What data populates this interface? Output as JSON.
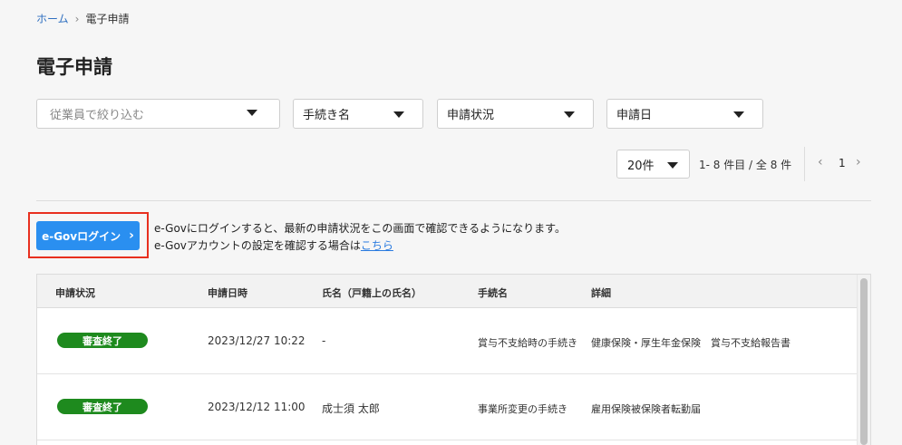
{
  "breadcrumb": {
    "home": "ホーム",
    "current": "電子申請"
  },
  "page_title": "電子申請",
  "filters": {
    "employee_placeholder": "従業員で絞り込む",
    "procedure": "手続き名",
    "status": "申請状況",
    "date": "申請日"
  },
  "pagination": {
    "per_page": "20件",
    "range": "1- 8 件目 /  全 8 件",
    "current_page": "1",
    "prev": "‹",
    "next": "›"
  },
  "egov": {
    "button_label": "e-Govログイン",
    "chevron": "›",
    "info_line1": "e-Govにログインすると、最新の申請状況をこの画面で確認できるようになります。",
    "info_line2_prefix": "e-Govアカウントの設定を確認する場合は",
    "info_line2_link": "こちら"
  },
  "table": {
    "headers": [
      "申請状況",
      "申請日時",
      "氏名（戸籍上の氏名）",
      "手続名",
      "詳細"
    ],
    "rows": [
      {
        "status": "審査終了",
        "datetime": "2023/12/27 10:22",
        "name": "-",
        "procedure": "賞与不支給時の手続き",
        "detail": "健康保険・厚生年金保険　賞与不支給報告書"
      },
      {
        "status": "審査終了",
        "datetime": "2023/12/12 11:00",
        "name": "成士須 太郎",
        "procedure": "事業所変更の手続き",
        "detail": "雇用保険被保険者転勤届"
      }
    ]
  },
  "colors": {
    "accent": "#2a8ff0",
    "badge": "#1e8a1e",
    "highlight": "#e8301f",
    "link": "#2a7be0"
  }
}
